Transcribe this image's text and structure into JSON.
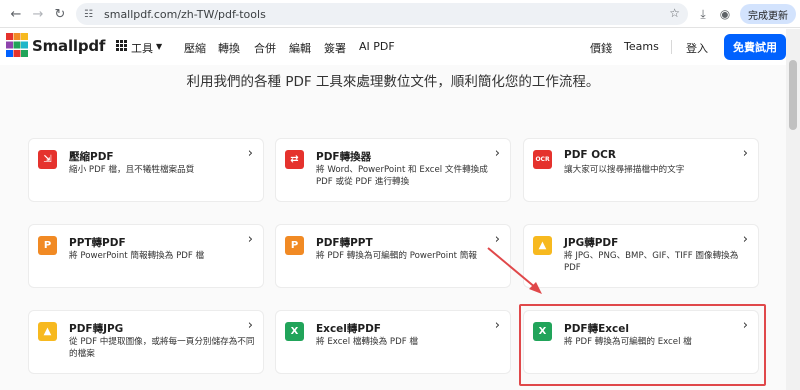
{
  "browser": {
    "url": "smallpdf.com/zh-TW/pdf-tools",
    "update_label": "完成更新"
  },
  "header": {
    "brand": "Smallpdf",
    "nav": {
      "tools": "工具",
      "compress": "壓縮",
      "convert": "轉換",
      "merge": "合併",
      "edit": "編輯",
      "sign": "簽署",
      "ai_pdf": "AI PDF",
      "pricing": "價錢",
      "teams": "Teams",
      "login": "登入",
      "free_trial": "免費試用"
    }
  },
  "main": {
    "headline": "利用我們的各種 PDF 工具來處理數位文件，順利簡化您的工作流程。",
    "cards": [
      {
        "title": "壓縮PDF",
        "desc": "縮小 PDF 檔，且不犧牲檔案品質",
        "icon": "compress-icon",
        "color": "#e5322d",
        "glyph": "⇲"
      },
      {
        "title": "PDF轉換器",
        "desc": "將 Word、PowerPoint 和 Excel 文件轉換成 PDF 或從 PDF 進行轉換",
        "icon": "convert-icon",
        "color": "#e5322d",
        "glyph": "⇄"
      },
      {
        "title": "PDF OCR",
        "desc": "讓大家可以搜尋掃描檔中的文字",
        "icon": "ocr-icon",
        "color": "#e5322d",
        "glyph": "OCR"
      },
      {
        "title": "PPT轉PDF",
        "desc": "將 PowerPoint 簡報轉換為 PDF 檔",
        "icon": "powerpoint-icon",
        "color": "#f18a24",
        "glyph": "P"
      },
      {
        "title": "PDF轉PPT",
        "desc": "將 PDF 轉換為可編輯的 PowerPoint 簡報",
        "icon": "powerpoint-icon",
        "color": "#f18a24",
        "glyph": "P"
      },
      {
        "title": "JPG轉PDF",
        "desc": "將 JPG、PNG、BMP、GIF、TIFF 圖像轉換為 PDF",
        "icon": "image-icon",
        "color": "#f7b91f",
        "glyph": "▲"
      },
      {
        "title": "PDF轉JPG",
        "desc": "從 PDF 中提取圖像，或將每一頁分別儲存為不同的檔案",
        "icon": "image-icon",
        "color": "#f7b91f",
        "glyph": "▲"
      },
      {
        "title": "Excel轉PDF",
        "desc": "將 Excel 檔轉換為 PDF 檔",
        "icon": "excel-icon",
        "color": "#21a45a",
        "glyph": "X"
      },
      {
        "title": "PDF轉Excel",
        "desc": "將 PDF 轉換為可編輯的 Excel 檔",
        "icon": "excel-icon",
        "color": "#21a45a",
        "glyph": "X"
      }
    ]
  },
  "annotation": {
    "color": "#e0484a"
  }
}
